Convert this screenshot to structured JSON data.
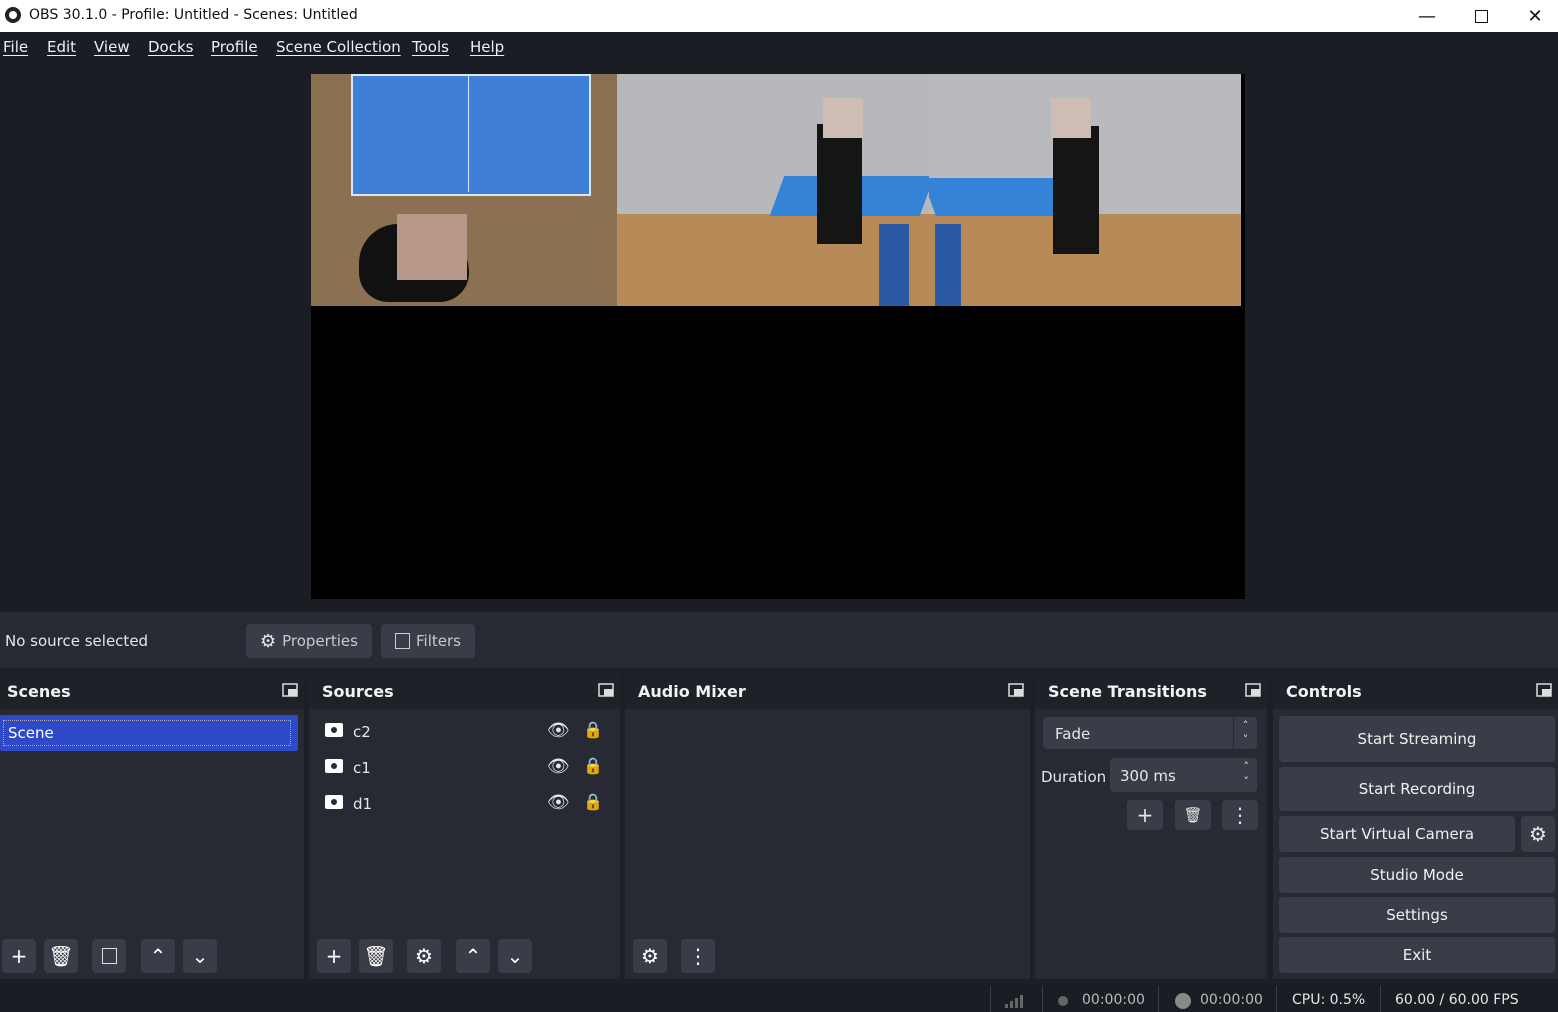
{
  "window": {
    "title": "OBS 30.1.0 - Profile: Untitled - Scenes: Untitled"
  },
  "menu": [
    "File",
    "Edit",
    "View",
    "Docks",
    "Profile",
    "Scene Collection",
    "Tools",
    "Help"
  ],
  "source_bar": {
    "status": "No source selected",
    "properties": "Properties",
    "filters": "Filters"
  },
  "scenes": {
    "title": "Scenes",
    "items": [
      "Scene"
    ]
  },
  "sources": {
    "title": "Sources",
    "items": [
      "c2",
      "c1",
      "d1"
    ]
  },
  "audio_mixer": {
    "title": "Audio Mixer"
  },
  "transitions": {
    "title": "Scene Transitions",
    "selected": "Fade",
    "duration_label": "Duration",
    "duration_value": "300 ms"
  },
  "controls": {
    "title": "Controls",
    "start_streaming": "Start Streaming",
    "start_recording": "Start Recording",
    "start_virtual_camera": "Start Virtual Camera",
    "studio_mode": "Studio Mode",
    "settings": "Settings",
    "exit": "Exit"
  },
  "status": {
    "stream_time": "00:00:00",
    "record_time": "00:00:00",
    "cpu": "CPU: 0.5%",
    "fps": "60.00 / 60.00 FPS"
  },
  "colors": {
    "accent": "#2f4ac9",
    "background": "#1d1f26",
    "panel": "#272a33"
  }
}
